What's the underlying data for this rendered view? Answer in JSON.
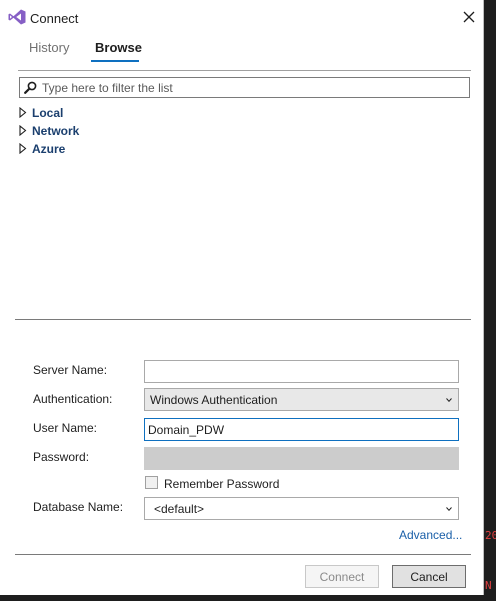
{
  "window": {
    "title": "Connect"
  },
  "tabs": [
    {
      "label": "History",
      "active": false
    },
    {
      "label": "Browse",
      "active": true
    }
  ],
  "filter": {
    "placeholder": "Type here to filter the list",
    "value": ""
  },
  "tree": [
    {
      "label": "Local"
    },
    {
      "label": "Network"
    },
    {
      "label": "Azure"
    }
  ],
  "form": {
    "server_name": {
      "label": "Server Name:",
      "value": ""
    },
    "authentication": {
      "label": "Authentication:",
      "value": "Windows Authentication"
    },
    "user_name": {
      "label": "User Name:",
      "value": "Domain_PDW"
    },
    "password": {
      "label": "Password:",
      "value": ""
    },
    "remember": {
      "label": "Remember Password",
      "checked": false
    },
    "database_name": {
      "label": "Database Name:",
      "value": "<default>"
    }
  },
  "advanced_label": "Advanced...",
  "buttons": {
    "connect": "Connect",
    "cancel": "Cancel"
  },
  "background_text": {
    "top": "20",
    "bottom": "N"
  },
  "colors": {
    "accent": "#0e70c0",
    "tree_text": "#1b3f6e",
    "link": "#1a5fa8",
    "vs_purple": "#865fc5"
  }
}
